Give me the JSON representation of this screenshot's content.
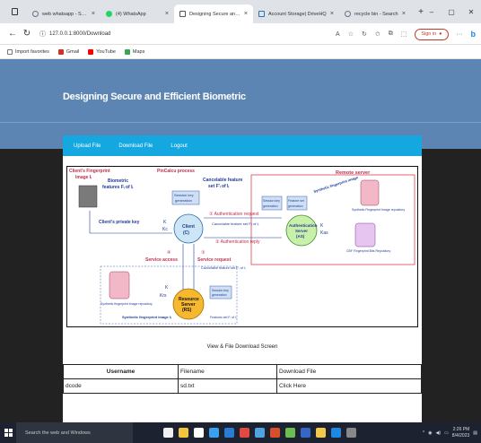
{
  "tabs": [
    {
      "title": "web whatsapp - Search",
      "icon": "search-icon",
      "color": "#6b7280"
    },
    {
      "title": "(4) WhatsApp",
      "icon": "whatsapp-icon",
      "color": "#25d366"
    },
    {
      "title": "Designing Secure and Efficie",
      "icon": "page-icon",
      "color": "#555555",
      "active": true
    },
    {
      "title": "Account Storage| DriveHQ",
      "icon": "drivehq-icon",
      "color": "#2f6fb3"
    },
    {
      "title": "recycle bin - Search",
      "icon": "search-icon",
      "color": "#6b7280"
    }
  ],
  "address": {
    "url": "127.0.0.1:8000/Download"
  },
  "signin_label": "Sign in",
  "bookmarks": [
    {
      "label": "Import favorites",
      "color": "#777777"
    },
    {
      "label": "Gmail",
      "color": "#d93025"
    },
    {
      "label": "YouTube",
      "color": "#ff0000"
    },
    {
      "label": "Maps",
      "color": "#34a853"
    }
  ],
  "page": {
    "title": "Designing Secure and Efficient Biometric",
    "menu": [
      "Upload File",
      "Download File",
      "Logout"
    ],
    "caption": "View & File Download Screen"
  },
  "figure": {
    "client_fp": "Client's Fingerprint",
    "image_i": "Image Iᵢ",
    "biometric": "Biometric",
    "features": "features Fᵢ of Iᵢ",
    "pincalcu": "PinCalcu process",
    "cancelable": "Cancelable feature",
    "set_f": "set F'ᵢ of Iᵢ",
    "remote": "Remote server",
    "session_key1": "Session key",
    "session_key2": "generation",
    "client1": "Client",
    "client2": "(C)",
    "private_key": "Client's private key",
    "auth_request": "① Authentication request",
    "auth_sub": "Cancelable feature set F'ᵢ of Iᵢ",
    "auth_reply": "② Authentication reply",
    "as1": "Authentication",
    "as2": "Server",
    "as3": "(AS)",
    "feature_set": "Feature set",
    "fs_gen": "generation",
    "synth": "Synthetic fingerprint image",
    "synth_repo": "Synthetic Fingerprint Image repository",
    "cbf": "CBF Fingerprint Bits Repository",
    "service_access": "Service access",
    "service_request": "Service request",
    "canc_small": "Cancelable feature set F'ᵢ of Iᵢ",
    "rs1": "Resource",
    "rs2": "Server",
    "rs3": "(RS)",
    "synth_repo2": "Synthetic fingerprint image repository",
    "synth_img": "Synthetic fingerprint image Iᵢ",
    "features_small": "Features set Fᵢ of Iᵢ",
    "k": "K",
    "kc": "Kc",
    "kas": "Kas",
    "krs": "Krs",
    "n4": "④",
    "n3": "③"
  },
  "table": {
    "headers": [
      "Username",
      "Filename",
      "Download File"
    ],
    "rows": [
      [
        "dcode",
        "sd.txt",
        "Click Here"
      ]
    ]
  },
  "taskbar": {
    "search": "Search the web and Windows",
    "time": "2:26 PM",
    "date": "8/4/2023",
    "apps": [
      "#f0f0f0",
      "#f5c542",
      "#ffffff",
      "#3aa0f0",
      "#2a7bd4",
      "#e04a3f",
      "#4fa3e0",
      "#d94f2a",
      "#6bbf4e",
      "#3467c8",
      "#f2c94c",
      "#1e88e5",
      "#888888"
    ]
  },
  "colors": {
    "hero": "#5d85b3",
    "menu": "#14a7e0",
    "dark": "#222222",
    "taskbar": "#1c2230"
  }
}
